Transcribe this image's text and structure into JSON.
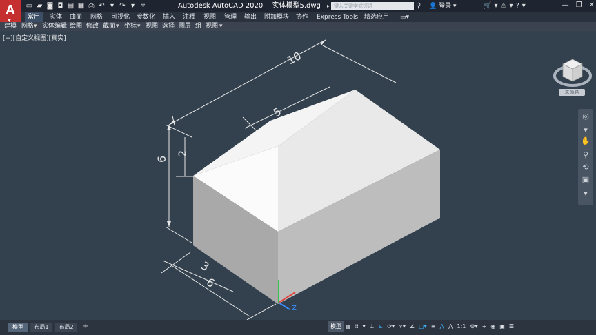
{
  "app": {
    "logo_letter": "A",
    "title": "Autodesk AutoCAD 2020",
    "filename": "实体模型5.dwg"
  },
  "search": {
    "placeholder": "键入关键字或短语"
  },
  "user": {
    "login_label": "登录"
  },
  "ribbon_tabs": [
    "常用",
    "实体",
    "曲面",
    "网格",
    "可视化",
    "参数化",
    "插入",
    "注释",
    "视图",
    "管理",
    "输出",
    "附加模块",
    "协作",
    "Express Tools",
    "精选应用"
  ],
  "panels": [
    "建模",
    "网格",
    "实体编辑",
    "绘图",
    "修改",
    "截面",
    "坐标",
    "视图",
    "选择",
    "图层",
    "组",
    "视图"
  ],
  "viewport": {
    "label": "[−][自定义视图][真实]",
    "viewcube_label": "未命名"
  },
  "dimensions": [
    "10",
    "5",
    "6",
    "2",
    "3",
    "6"
  ],
  "ucs_axis": "Z",
  "layout_tabs": [
    "模型",
    "布局1",
    "布局2"
  ],
  "status": {
    "model_label": "模型",
    "scale": "1:1"
  },
  "colors": {
    "accent": "#c62f2f",
    "background": "#33414f",
    "active_tab": "#3d4f66",
    "snap_on": "#3fb6ff"
  }
}
